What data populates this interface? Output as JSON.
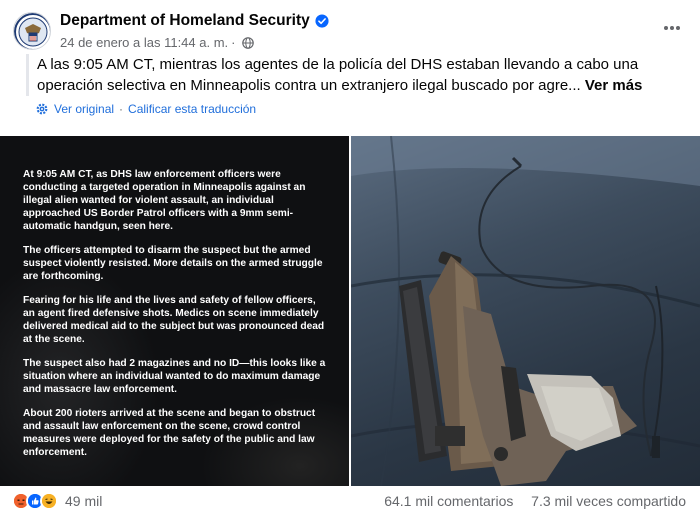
{
  "post": {
    "page_name": "Department of Homeland Security",
    "date": "24 de enero a las 11:44 a. m.",
    "date_separator": "·",
    "text": "A las 9:05 AM CT, mientras los agentes de la policía del DHS estaban llevando a cabo una operación selectiva en Minneapolis contra un extranjero ilegal buscado por agre...",
    "see_more": "Ver más",
    "see_original": "Ver original",
    "translate_dot": "·",
    "rate_translation": "Calificar esta traducción"
  },
  "image_statement": [
    "At 9:05 AM CT, as DHS law enforcement officers were conducting a targeted operation in Minneapolis against an illegal alien wanted for violent assault, an individual approached US Border Patrol officers with a 9mm semi-automatic handgun, seen here.",
    "The officers attempted to disarm the suspect but the armed suspect violently resisted. More details on the armed struggle are forthcoming.",
    "Fearing for his life and the lives and safety of fellow officers, an agent fired defensive shots. Medics on scene immediately delivered medical aid to the subject but was pronounced dead at the scene.",
    "The suspect also had 2 magazines and no ID—this looks like a situation where an individual wanted to do maximum damage and massacre law enforcement.",
    "About 200 rioters arrived at the scene and began to obstruct and assault law enforcement on the scene, crowd control measures were deployed for the safety of the public and law enforcement."
  ],
  "footer": {
    "reaction_count": "49 mil",
    "comments": "64.1 mil comentarios",
    "shares": "7.3 mil veces compartido"
  },
  "icons": {
    "verified": "verified-badge-icon",
    "privacy": "globe-icon",
    "translate": "gear-icon",
    "reactions": [
      "angry-icon",
      "like-icon",
      "haha-icon"
    ]
  },
  "colors": {
    "link": "#216fdb",
    "verified": "#0866ff",
    "secondary_text": "#65676b"
  }
}
